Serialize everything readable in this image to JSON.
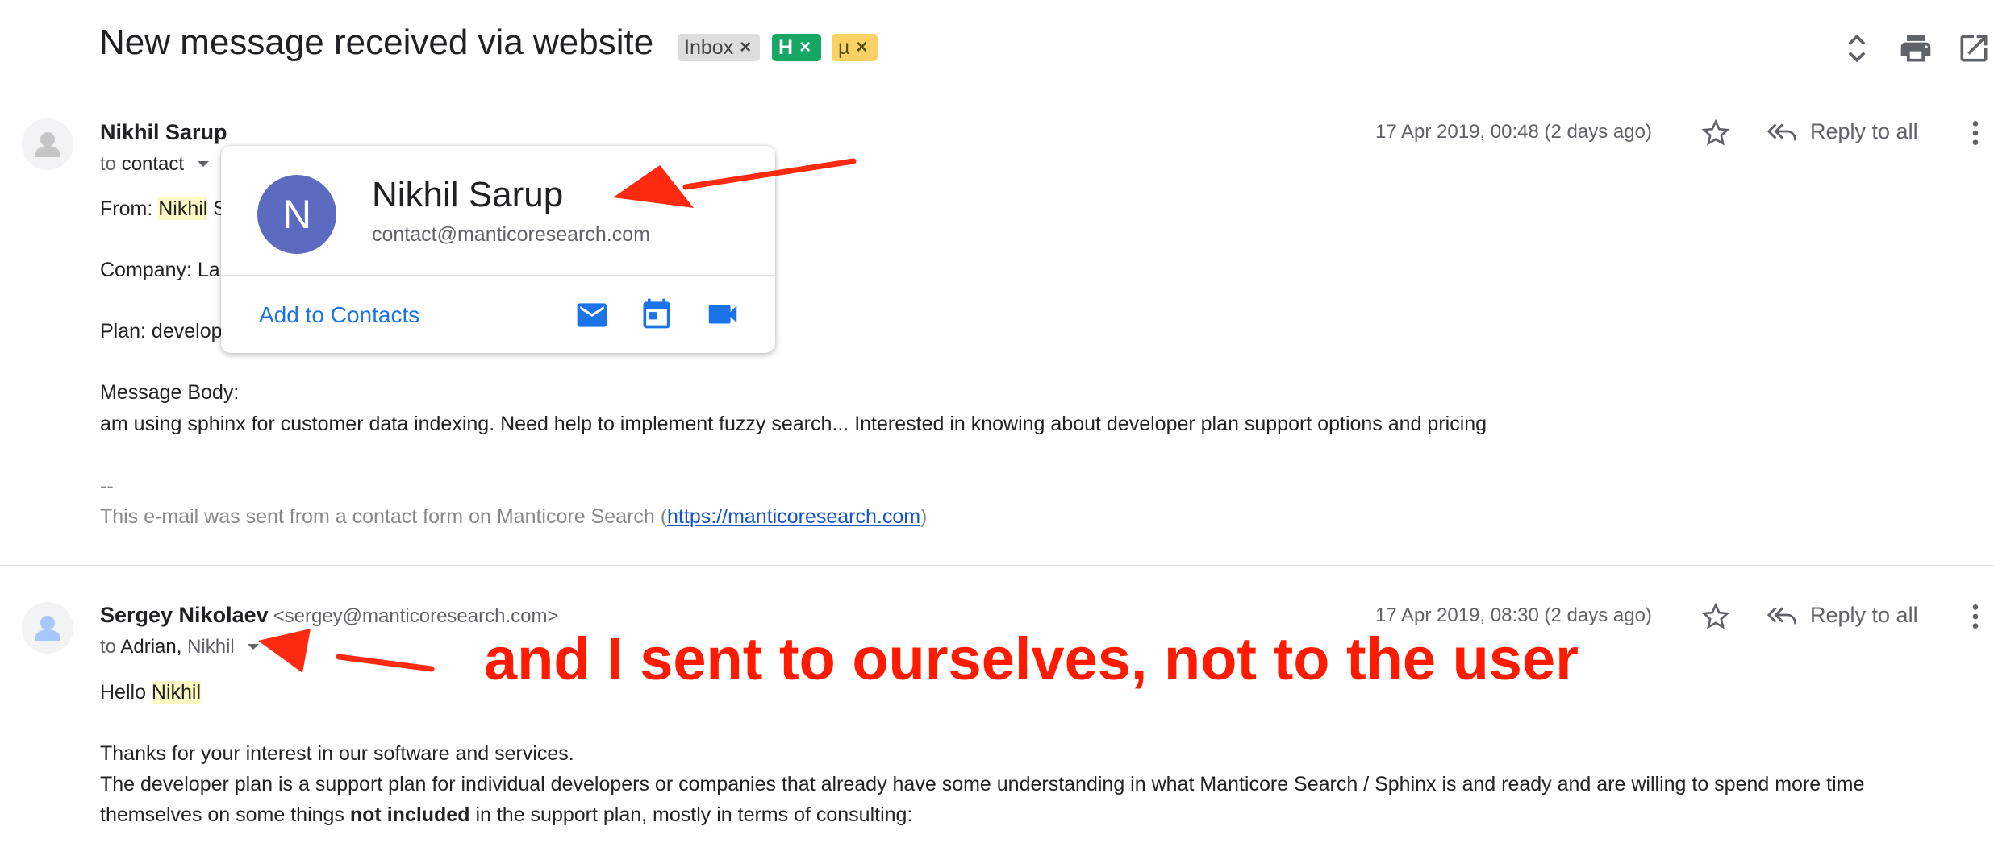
{
  "header": {
    "subject": "New message received via website",
    "labels": [
      {
        "text": "Inbox",
        "color": "#dddddd"
      },
      {
        "text": "H",
        "color": "#16a765"
      },
      {
        "text": "µ",
        "color": "#fad165"
      }
    ],
    "label_close": "×",
    "icons": [
      "expand-collapse-icon",
      "print-icon",
      "open-in-new-window-icon"
    ]
  },
  "messages": [
    {
      "sender": "Nikhil Sarup",
      "to_prefix": "to",
      "to": "contact",
      "date": "17 Apr 2019, 00:48 (2 days ago)",
      "reply_label": "Reply to all",
      "body": {
        "from_label": "From: ",
        "from_name": "Nikhil",
        "from_rest": " S",
        "company": "Company: La",
        "plan": "Plan: develop",
        "message_body_label": "Message Body:",
        "message": "am using sphinx for customer data indexing. Need help to implement fuzzy search... Interested in knowing about developer plan support options and pricing",
        "sig_sep": "--",
        "footer_prefix": "This e-mail was sent from a contact form on Manticore Search (",
        "footer_link": "https://manticoresearch.com",
        "footer_suffix": ")"
      }
    },
    {
      "sender": "Sergey Nikolaev",
      "sender_email": "<sergey@manticoresearch.com>",
      "to_prefix": "to",
      "to": "Adrian,",
      "to_second": "Nikhil",
      "date": "17 Apr 2019, 08:30 (2 days ago)",
      "reply_label": "Reply to all",
      "body": {
        "greeting_prefix": "Hello ",
        "greeting_name": "Nikhil",
        "line1": "Thanks for your interest in our software and services.",
        "line2": "The developer plan is a support plan for individual developers or companies that already have some understanding in what Manticore Search / Sphinx is and ready and are willing to spend more time",
        "line3_prefix": "themselves on some things ",
        "line3_bold": "not included",
        "line3_suffix": " in the support plan, mostly in terms of consulting:"
      }
    }
  ],
  "hovercard": {
    "initial": "N",
    "name": "Nikhil Sarup",
    "email": "contact@manticoresearch.com",
    "add_label": "Add to Contacts",
    "icons": [
      "email-icon",
      "calendar-icon",
      "video-call-icon"
    ],
    "avatar_color": "#5c6bc0"
  },
  "annotation": {
    "text": "and I sent to ourselves, not to the user",
    "color": "#ff1a00"
  }
}
